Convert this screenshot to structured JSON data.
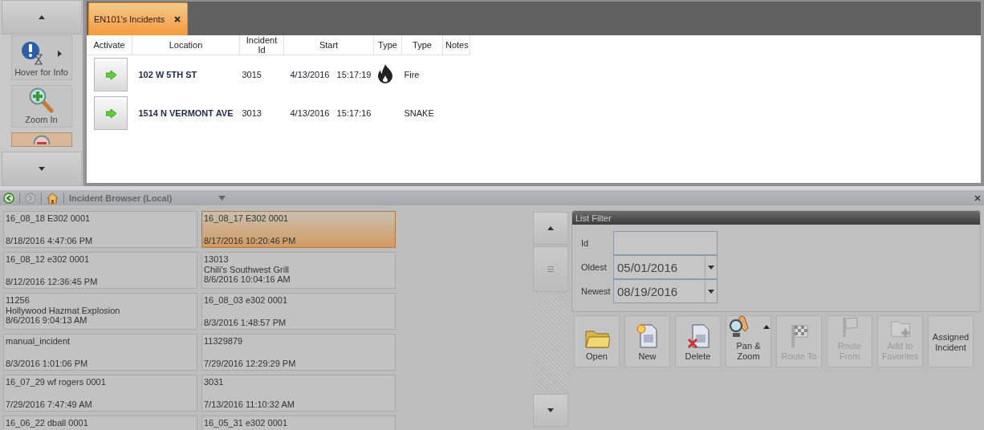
{
  "side_ribbon": {
    "items": [
      {
        "kind": "info",
        "label": "Hover for Info",
        "selected": false
      },
      {
        "kind": "zoom_in",
        "label": "Zoom In",
        "selected": false
      },
      {
        "kind": "zoom_out",
        "selected": true
      }
    ]
  },
  "tabs": [
    {
      "label": "EN101's Incidents",
      "selected": true
    }
  ],
  "incidents_table": {
    "columns": [
      "Activate",
      "Location",
      "Incident Id",
      "Start",
      "Type",
      "Type",
      "Notes"
    ],
    "rows": [
      {
        "location": "102 W 5TH ST",
        "incident_id": "3015",
        "start_date": "4/13/2016",
        "start_time": "15:17:19",
        "kind": "with_icon",
        "type": "Fire"
      },
      {
        "location": "1514 N VERMONT AVE",
        "incident_id": "3013",
        "start_date": "4/13/2016",
        "start_time": "15:17:16",
        "kind": "plain",
        "type": "SNAKE"
      }
    ]
  },
  "browser_toolbar": {
    "back_disabled": false,
    "forward_disabled": true,
    "title": "Incident Browser (Local)"
  },
  "incident_list": [
    {
      "title": "16_08_18 E302 0001",
      "date": "8/18/2016 4:47:06 PM",
      "selected": false
    },
    {
      "title": "16_08_17 E302 0001",
      "date": "8/17/2016 10:20:46 PM",
      "selected": true
    },
    {
      "title": "16_08_12 e302 0001",
      "date": "8/12/2016 12:36:45 PM",
      "selected": false
    },
    {
      "title": "13013",
      "subtitle": "Chili's Southwest Grill",
      "date": "8/6/2016 10:04:16 AM",
      "selected": false
    },
    {
      "title": "11256",
      "subtitle": "Hollywood Hazmat Explosion",
      "date": "8/6/2016 9:04:13 AM",
      "selected": false
    },
    {
      "title": "16_08_03 e302 0001",
      "date": "8/3/2016 1:48:57 PM",
      "selected": false
    },
    {
      "title": "manual_incident",
      "date": "8/3/2016 1:01:06 PM",
      "selected": false
    },
    {
      "title": "11329879",
      "date": "7/29/2016 12:29:29 PM",
      "selected": false
    },
    {
      "title": "16_07_29 wf rogers 0001",
      "date": "7/29/2016 7:47:49 AM",
      "selected": false
    },
    {
      "title": "3031",
      "date": "7/13/2016 11:10:32 AM",
      "selected": false
    },
    {
      "title": "16_06_22 dball 0001",
      "selected": false
    },
    {
      "title": "16_05_31 e302 0001",
      "selected": false
    }
  ],
  "list_filter": {
    "title": "List Filter",
    "fields": [
      {
        "kind": "text",
        "label": "Id"
      },
      {
        "kind": "date",
        "label": "Oldest",
        "value": "05/01/2016"
      },
      {
        "kind": "date",
        "label": "Newest",
        "value": "08/19/2016"
      }
    ]
  },
  "actions": [
    {
      "kind": "open",
      "label": "Open",
      "disabled": false
    },
    {
      "kind": "new",
      "label": "New",
      "disabled": false
    },
    {
      "kind": "delete",
      "label": "Delete",
      "disabled": false
    },
    {
      "kind": "pan",
      "label": "Pan & Zoom",
      "disabled": false
    },
    {
      "kind": "route_to",
      "label": "Route To",
      "disabled": true
    },
    {
      "kind": "route_from",
      "label": "Route From",
      "disabled": true
    },
    {
      "kind": "favorite",
      "label": "Add to Favorites",
      "disabled": true
    },
    {
      "kind": "text",
      "label": "Assigned Incident",
      "disabled": false
    }
  ]
}
